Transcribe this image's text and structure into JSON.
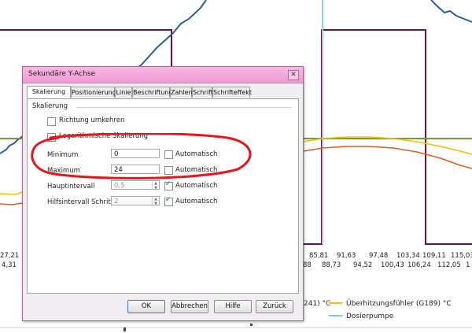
{
  "chart": {
    "x_ticks_left_top": [
      "27,21"
    ],
    "x_ticks_left_bottom": [
      "4,31"
    ],
    "x_ticks_right_top": [
      "85,81",
      "91,63",
      "97,48",
      "103,34",
      "109,11",
      "115,03"
    ],
    "x_ticks_right_bottom": [
      "88",
      "88,73",
      "94,52",
      "100,43",
      "106,24",
      "112,05",
      "1"
    ],
    "legend": {
      "partial_label": "241) °C",
      "items": [
        {
          "label": "Überhitzungsfühler (G189) °C",
          "color": "#f2c200"
        },
        {
          "label": "Dosierpumpe",
          "color": "#7fc7ef"
        }
      ]
    }
  },
  "dialog": {
    "title": "Sekundäre Y-Achse",
    "close_glyph": "✕",
    "tabs": [
      "Skalierung",
      "Positionierung",
      "Linie",
      "Beschriftung",
      "Zahlen",
      "Schrift",
      "Schrifteffekt"
    ],
    "section_label": "Skalierung",
    "reverse_direction_label": "Richtung umkehren",
    "log_scale_label": "Logarithmische Skalierung",
    "rows": [
      {
        "label": "Minimum",
        "value": "0",
        "auto_label": "Automatisch",
        "auto_checked": false,
        "disabled": false
      },
      {
        "label": "Maximum",
        "value": "24",
        "auto_label": "Automatisch",
        "auto_checked": false,
        "disabled": false
      },
      {
        "label": "Hauptintervall",
        "value": "0,5",
        "auto_label": "Automatisch",
        "auto_checked": true,
        "disabled": true
      },
      {
        "label": "Hilfsintervall Schritte",
        "value": "2",
        "auto_label": "Automatisch",
        "auto_checked": true,
        "disabled": true
      }
    ],
    "buttons": {
      "ok": "OK",
      "cancel": "Abbrechen",
      "help": "Hilfe",
      "back": "Zurück"
    }
  }
}
